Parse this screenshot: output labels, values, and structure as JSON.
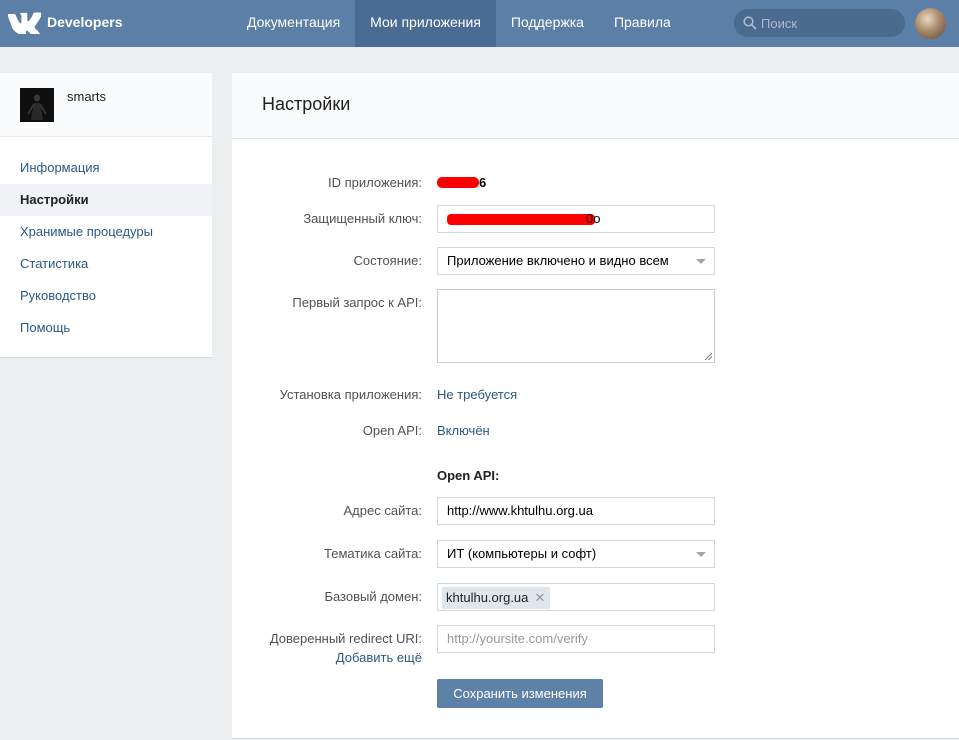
{
  "header": {
    "logo_text": "Developers",
    "nav": [
      {
        "label": "Документация"
      },
      {
        "label": "Мои приложения"
      },
      {
        "label": "Поддержка"
      },
      {
        "label": "Правила"
      }
    ],
    "search_placeholder": "Поиск",
    "colors": {
      "bar": "#5b7fa6",
      "active": "#4a6b94"
    }
  },
  "sidebar": {
    "app_name": "smarts",
    "items": [
      {
        "label": "Информация"
      },
      {
        "label": "Настройки"
      },
      {
        "label": "Хранимые процедуры"
      },
      {
        "label": "Статистика"
      },
      {
        "label": "Руководство"
      },
      {
        "label": "Помощь"
      }
    ]
  },
  "settings": {
    "title": "Настройки",
    "app_id_label": "ID приложения:",
    "app_id_suffix": "6",
    "secret_key_label": "Защищенный ключ:",
    "secret_key_suffix": "0o",
    "state_label": "Состояние:",
    "state_value": "Приложение включено и видно всем",
    "first_api_label": "Первый запрос к API:",
    "install_label": "Установка приложения:",
    "install_value": "Не требуется",
    "open_api_label": "Open API:",
    "open_api_value": "Включён",
    "open_api_section": "Open API:",
    "site_address_label": "Адрес сайта:",
    "site_address_value": "http://www.khtulhu.org.ua",
    "site_topic_label": "Тематика сайта:",
    "site_topic_value": "ИТ (компьютеры и софт)",
    "base_domain_label": "Базовый домен:",
    "base_domain_tag": "khtulhu.org.ua",
    "redirect_label": "Доверенный redirect URI:",
    "redirect_placeholder": "http://yoursite.com/verify",
    "add_more": "Добавить ещё",
    "save_button": "Сохранить изменения"
  }
}
